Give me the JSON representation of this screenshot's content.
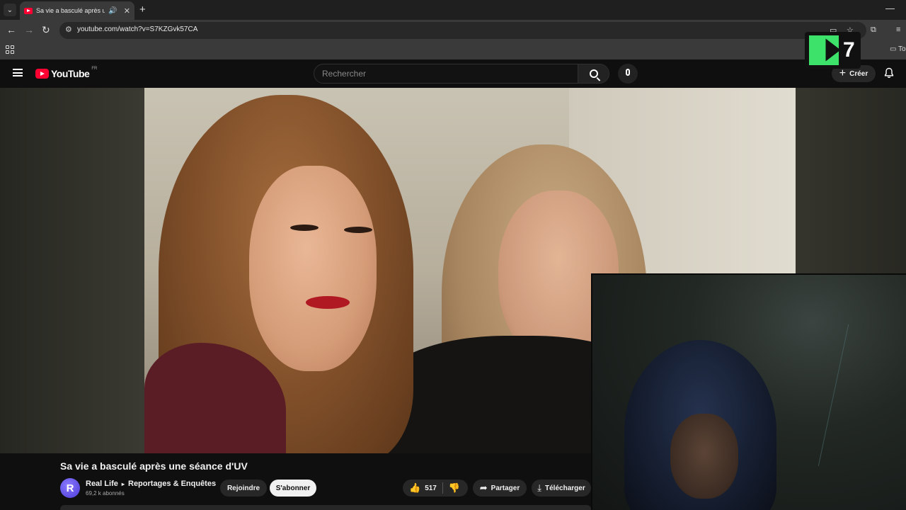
{
  "browser": {
    "tab_title": "Sa vie a basculé après une s",
    "url": "youtube.com/watch?v=S7KZGvk57CA",
    "bookmark_folder": "To"
  },
  "header": {
    "logo_text": "YouTube",
    "country_code": "FR",
    "search_placeholder": "Rechercher",
    "create_label": "Créer"
  },
  "overlay_logo": {
    "text": "7"
  },
  "video": {
    "title": "Sa vie a basculé après une séance d'UV",
    "channel_initial": "R",
    "channel_name": "Real Life",
    "channel_category": "Reportages & Enquêtes",
    "subscribers": "69,2 k abonnés",
    "join_label": "Rejoindre",
    "subscribe_label": "S'abonner",
    "likes": "517",
    "share_label": "Partager",
    "download_label": "Télécharger"
  },
  "colors": {
    "youtube_red": "#ff0033",
    "k7_green": "#3de26b",
    "background": "#0f0f0f"
  }
}
